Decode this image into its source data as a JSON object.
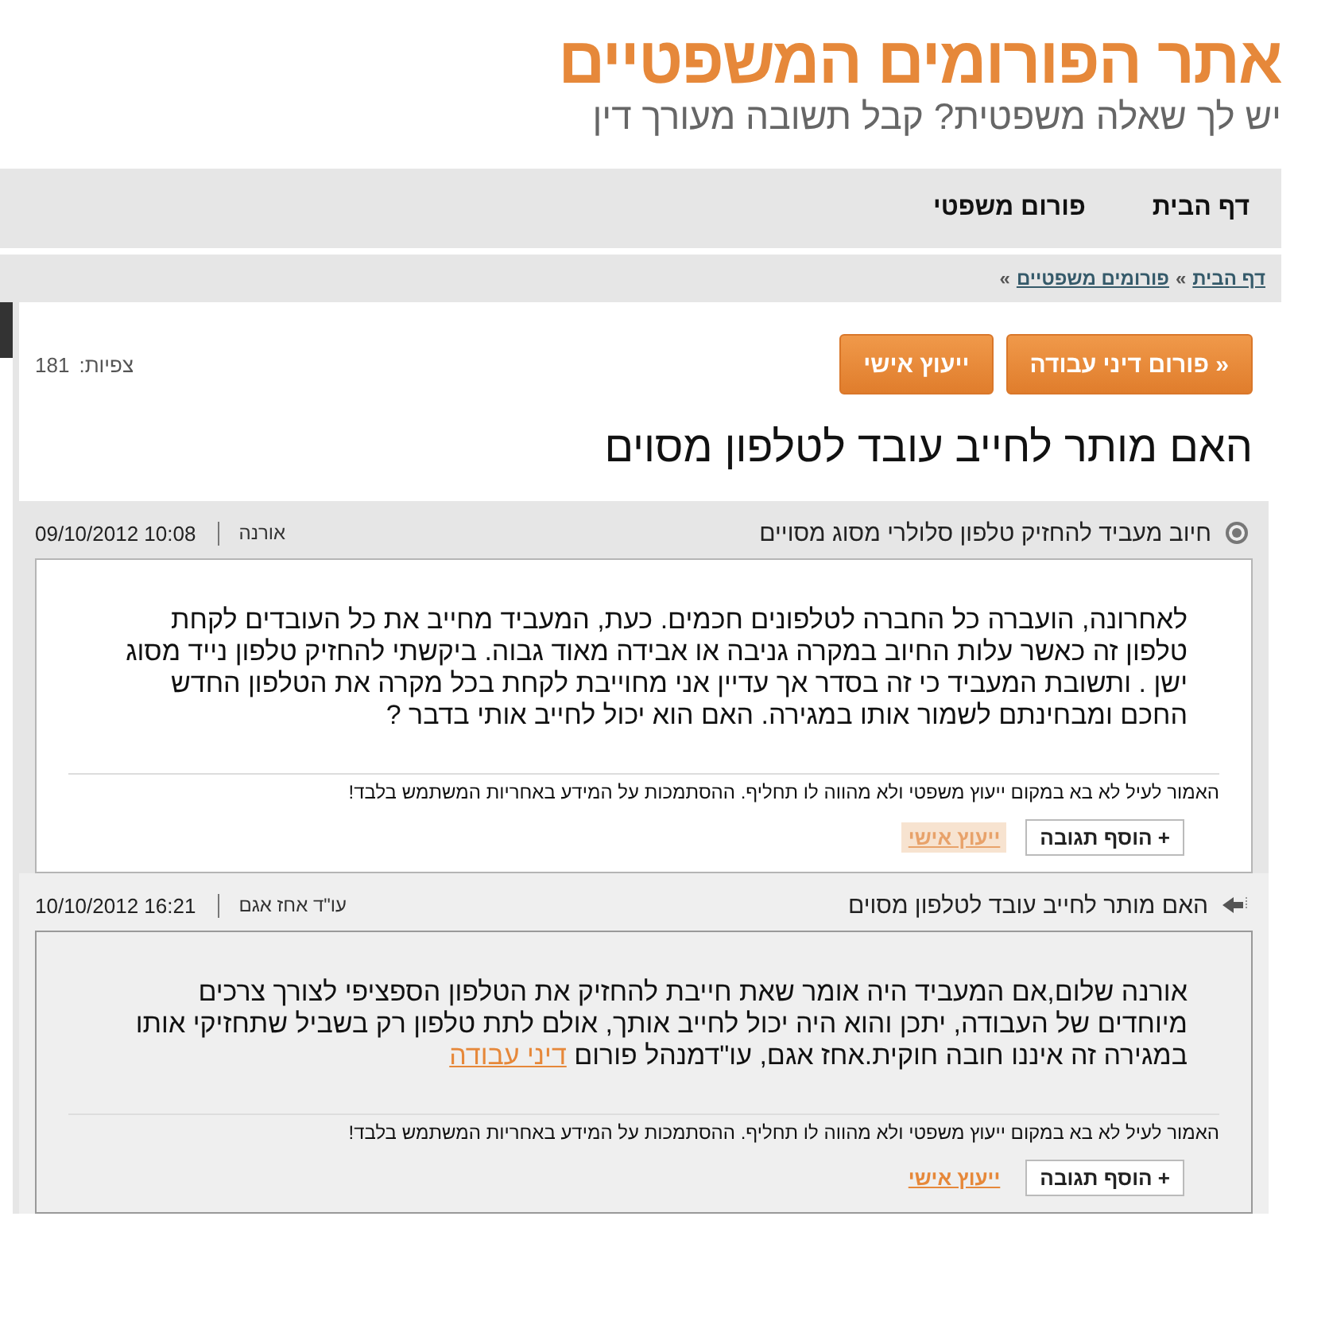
{
  "site": {
    "title": "אתר הפורומים המשפטיים",
    "tagline": "יש לך שאלה משפטית? קבל תשובה מעורך דין"
  },
  "nav": [
    {
      "label": "דף הבית"
    },
    {
      "label": "פורום משפטי"
    }
  ],
  "breadcrumb": {
    "items": [
      "דף הבית",
      "פורומים משפטיים"
    ],
    "separator": "»"
  },
  "actions": [
    {
      "label": "« פורום דיני עבודה"
    },
    {
      "label": "ייעוץ אישי"
    }
  ],
  "views": {
    "label": "צפיות:",
    "value": "181"
  },
  "thread_title": "האם מותר לחייב עובד לטלפון מסוים",
  "posts": [
    {
      "kind": "post",
      "subject": "חיוב מעביד להחזיק טלפון סלולרי מסוג מסויים",
      "author": "אורנה",
      "date": "09/10/2012 10:08",
      "body": "לאחרונה, הועברה כל החברה לטלפונים חכמים. כעת, המעביד מחייב את כל העובדים לקחת טלפון זה כאשר עלות החיוב במקרה גניבה או אבידה מאוד גבוה. ביקשתי להחזיק טלפון נייד מסוג ישן . ותשובת המעביד כי זה בסדר אך עדיין אני מחוייבת לקחת בכל מקרה את הטלפון החדש החכם ומבחינתם לשמור אותו במגירה. האם הוא יכול לחייב אותי בדבר ?",
      "disclaimer": "האמור לעיל לא בא במקום ייעוץ משפטי ולא מהווה לו תחליף. ההסתמכות על המידע באחריות המשתמש בלבד!",
      "reply_button": "+ הוסף תגובה",
      "consult": {
        "label": "ייעוץ אישי",
        "highlighted": true
      }
    },
    {
      "kind": "reply",
      "subject": "האם מותר לחייב עובד לטלפון מסוים",
      "author": "עו\"ד אחז אגם",
      "date": "10/10/2012 16:21",
      "body": "אורנה שלום,אם המעביד היה אומר שאת חייבת להחזיק את הטלפון הספציפי לצורך צרכים מיוחדים של העבודה, יתכן והוא היה יכול לחייב אותך, אולם לתת טלפון רק בשביל שתחזיקי אותו במגירה זה איננו חובה חוקית.אחז אגם, עו\"דמנהל פורום",
      "link": "דיני עבודה",
      "disclaimer": "האמור לעיל לא בא במקום ייעוץ משפטי ולא מהווה לו תחליף. ההסתמכות על המידע באחריות המשתמש בלבד!",
      "reply_button": "+ הוסף תגובה",
      "consult": {
        "label": "ייעוץ אישי",
        "highlighted": false
      }
    }
  ]
}
